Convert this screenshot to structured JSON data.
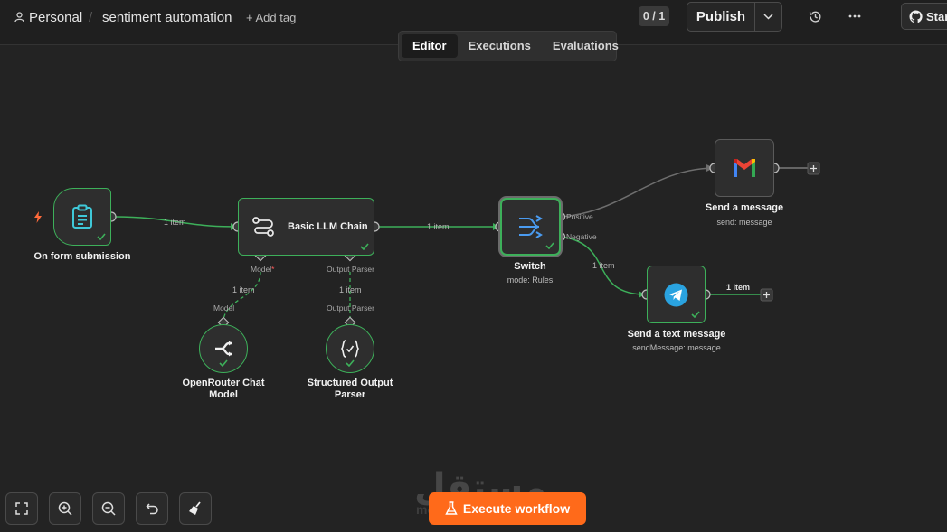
{
  "header": {
    "project": "Personal",
    "workflow_name": "sentiment automation",
    "add_tag": "+ Add tag",
    "counter": "0 / 1",
    "publish_label": "Publish",
    "star_label": "Star"
  },
  "tabs": [
    {
      "label": "Editor",
      "active": true
    },
    {
      "label": "Executions",
      "active": false
    },
    {
      "label": "Evaluations",
      "active": false
    }
  ],
  "nodes": {
    "trigger": {
      "title": "On form submission",
      "icon": "clipboard-icon"
    },
    "llm": {
      "title": "Basic LLM Chain",
      "icon": "chain-icon",
      "port_model": "Model",
      "port_parser": "Output Parser"
    },
    "switch": {
      "title": "Switch",
      "subtitle": "mode: Rules",
      "out_positive": "Positive",
      "out_negative": "Negative"
    },
    "gmail": {
      "title": "Send a message",
      "subtitle": "send: message",
      "icon": "gmail-icon"
    },
    "telegram": {
      "title": "Send a text message",
      "subtitle": "sendMessage: message",
      "icon": "telegram-icon"
    },
    "openrouter": {
      "title_line1": "OpenRouter Chat",
      "title_line2": "Model",
      "port": "Model"
    },
    "parser": {
      "title_line1": "Structured Output",
      "title_line2": "Parser",
      "port": "Output Parser"
    }
  },
  "edge_labels": {
    "trigger_llm": "1 item",
    "llm_switch": "1 item",
    "switch_telegram": "1 item",
    "telegram_out": "1 item",
    "model_edge": "1 item",
    "parser_edge": "1 item"
  },
  "required_mark": "*",
  "footer": {
    "execute_label": "Execute workflow",
    "watermark": "مستقل",
    "watermark_sub": "mostaql.com"
  },
  "colors": {
    "accent_green": "#3db05a",
    "execute_orange": "#ff6a1a",
    "canvas_bg": "#232323"
  }
}
